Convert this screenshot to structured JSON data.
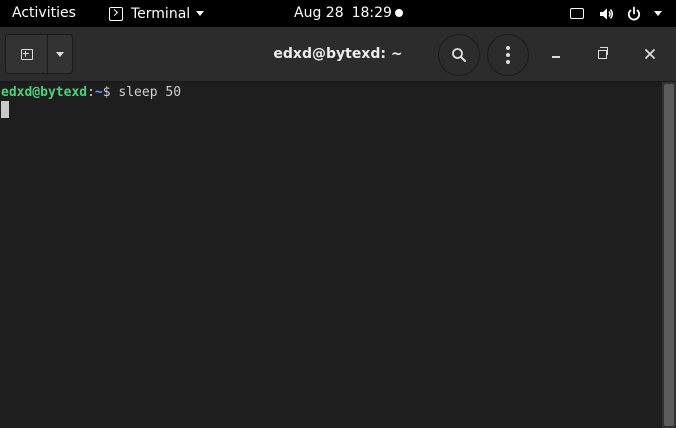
{
  "topbar": {
    "activities": "Activities",
    "app_label": "Terminal",
    "date": "Aug 28",
    "time": "18:29"
  },
  "window": {
    "title": "edxd@bytexd: ~"
  },
  "terminal": {
    "prompt_user": "edxd@bytexd",
    "prompt_sep": ":",
    "prompt_path": "~",
    "prompt_symbol": "$ ",
    "command": "sleep 50"
  },
  "icons": {
    "app": "terminal-icon",
    "tray": [
      "screen-icon",
      "speaker-icon",
      "power-icon",
      "chevron-down-icon"
    ],
    "header": [
      "new-tab-icon",
      "chevron-down-icon",
      "search-icon",
      "kebab-menu-icon",
      "minimize-icon",
      "maximize-icon",
      "close-icon"
    ]
  },
  "colors": {
    "topbar_bg": "#000000",
    "header_bg": "#2c2c2c",
    "terminal_bg": "#1e1e1e",
    "prompt_user": "#4ed07a",
    "prompt_path": "#5f9fff",
    "text": "#d0d0d0"
  }
}
